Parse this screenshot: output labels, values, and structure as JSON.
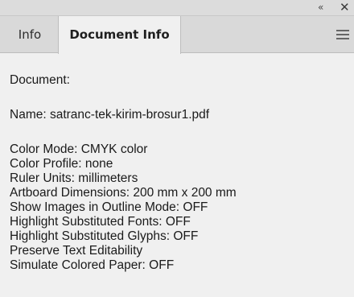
{
  "window": {
    "collapse_glyph": "«",
    "close_glyph": "✕"
  },
  "tabs": [
    {
      "label": "Info",
      "active": false
    },
    {
      "label": "Document Info",
      "active": true
    }
  ],
  "content": {
    "document_label": "Document:",
    "name_line": "Name: satranc-tek-kirim-brosur1.pdf",
    "properties": [
      "Color Mode: CMYK color",
      "Color Profile: none",
      "Ruler Units: millimeters",
      "Artboard Dimensions: 200 mm x 200 mm",
      "Show Images in Outline Mode: OFF",
      "Highlight Substituted Fonts: OFF",
      "Highlight Substituted Glyphs: OFF",
      "Preserve Text Editability",
      "Simulate Colored Paper: OFF"
    ]
  },
  "icons": {
    "collapse": "collapse-icon",
    "close": "close-icon",
    "panel_menu": "panel-menu-icon"
  }
}
